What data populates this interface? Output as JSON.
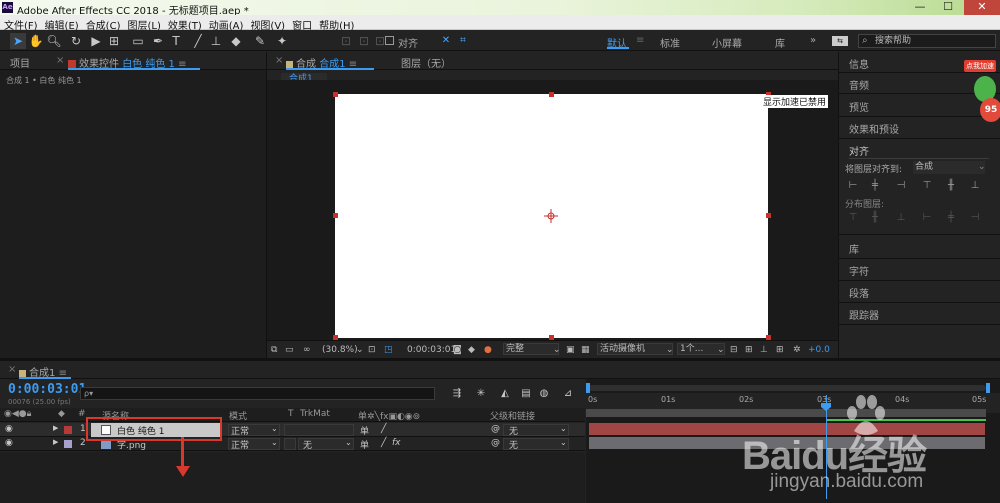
{
  "titlebar": {
    "logo": "Ae",
    "title": "Adobe After Effects CC 2018 - 无标题项目.aep *",
    "minimize": "—",
    "maximize": "☐",
    "close": "✕"
  },
  "menu": [
    "文件(F)",
    "编辑(E)",
    "合成(C)",
    "图层(L)",
    "效果(T)",
    "动画(A)",
    "视图(V)",
    "窗口",
    "帮助(H)"
  ],
  "toolbar": {
    "align_label": "对齐",
    "workspaces": [
      "默认",
      "标准",
      "小屏幕",
      "库"
    ],
    "more": "»",
    "search_placeholder": "搜索帮助"
  },
  "left_panel": {
    "tab_project": "项目",
    "tab_effects_prefix": "效果控件",
    "tab_effects_layer": "白色 纯色 1",
    "breadcrumb": "合成 1 • 白色 纯色 1"
  },
  "comp_panel": {
    "tab_comp_prefix": "合成",
    "tab_comp_name": "合成1",
    "tab_layer": "图层（无）",
    "sub_tab": "合成1",
    "accel_notice": "显示加速已禁用",
    "footer": {
      "zoom": "(30.8%)",
      "timecode": "0:00:03:01",
      "quality": "完整",
      "camera": "活动摄像机",
      "views": "1个...",
      "exposure": "+0.0"
    }
  },
  "right_panel": {
    "items": [
      "信息",
      "音频",
      "预览",
      "效果和预设"
    ],
    "align_title": "对齐",
    "align_to_label": "将图层对齐到:",
    "align_to_value": "合成",
    "distribute_label": "分布图层:",
    "bottom_items": [
      "库",
      "字符",
      "段落",
      "跟踪器"
    ],
    "mascot_badge": "点我加速",
    "mascot_number": "95"
  },
  "timeline": {
    "tab_label": "合成1",
    "timecode": "0:00:03:01",
    "fps": "00076 (25.00 fps)",
    "search_icon_label": "ρ▾",
    "headers": {
      "num": "#",
      "name": "源名称",
      "mode": "模式",
      "t": "T",
      "trkmat": "TrkMat",
      "parent": "父级和链接"
    },
    "layers": [
      {
        "num": "1",
        "name": "白色 纯色 1",
        "color": "#b53a3a",
        "mode": "正常",
        "trkmat": "",
        "parent": "无"
      },
      {
        "num": "2",
        "name": "字.png",
        "color": "#a6a0cc",
        "mode": "正常",
        "trkmat": "无",
        "parent": "无"
      }
    ],
    "ruler": [
      "0s",
      "01s",
      "02s",
      "03s",
      "04s",
      "05s"
    ]
  },
  "watermark": {
    "brand": "Baidu经验",
    "url": "jingyan.baidu.com"
  },
  "colors": {
    "accent": "#3d9cf0",
    "annotation_red": "#d9382c",
    "layer1_bar": "#a24545",
    "layer2_bar": "#6b6b70"
  }
}
